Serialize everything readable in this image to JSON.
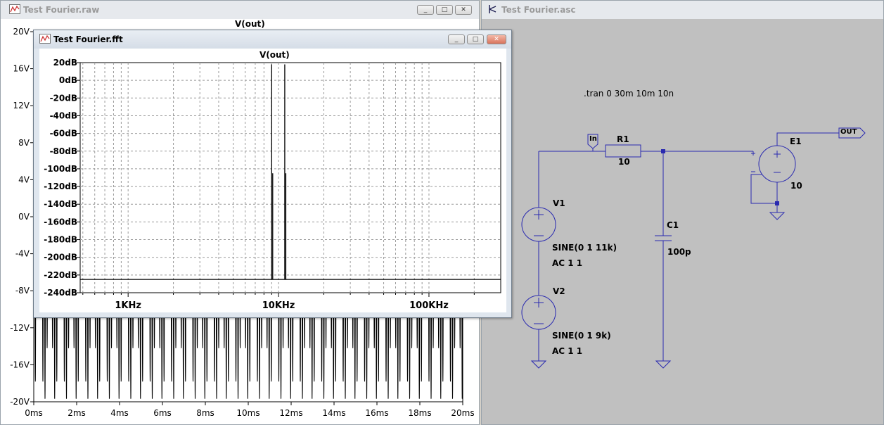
{
  "raw_window": {
    "title": "Test Fourier.raw",
    "trace_name": "V(out)",
    "y_ticks": [
      "20V",
      "16V",
      "12V",
      "8V",
      "4V",
      "0V",
      "-4V",
      "-8V",
      "-12V",
      "-16V",
      "-20V"
    ],
    "x_ticks": [
      "0ms",
      "2ms",
      "4ms",
      "6ms",
      "8ms",
      "10ms",
      "12ms",
      "14ms",
      "16ms",
      "18ms",
      "20ms"
    ],
    "buttons": {
      "minimize": "_",
      "maximize": "□",
      "close": "✕"
    }
  },
  "fft_window": {
    "title": "Test Fourier.fft",
    "trace_name": "V(out)",
    "buttons": {
      "minimize": "_",
      "maximize": "□",
      "close": "✕"
    }
  },
  "asc_window": {
    "title": "Test Fourier.asc",
    "directive": ".tran 0 30m 10m 10n",
    "components": {
      "in_label": "In",
      "r1_name": "R1",
      "r1_value": "10",
      "c1_name": "C1",
      "c1_value": "100p",
      "v1_name": "V1",
      "v1_value": "SINE(0 1 11k)",
      "v1_ac": "AC 1 1",
      "v2_name": "V2",
      "v2_value": "SINE(0 1 9k)",
      "v2_ac": "AC 1 1",
      "e1_name": "E1",
      "e1_value": "10",
      "out_label": "OUT"
    },
    "buttons": {
      "minimize": "_",
      "maximize": "□",
      "close": "✕"
    }
  },
  "chart_data": [
    {
      "type": "line",
      "title": "V(out)",
      "xlabel": "",
      "ylabel": "",
      "x_ticks": [
        "0ms",
        "2ms",
        "4ms",
        "6ms",
        "8ms",
        "10ms",
        "12ms",
        "14ms",
        "16ms",
        "18ms",
        "20ms"
      ],
      "y_ticks": [
        "20V",
        "16V",
        "12V",
        "8V",
        "4V",
        "0V",
        "-4V",
        "-8V",
        "-12V",
        "-16V",
        "-20V"
      ],
      "xlim": [
        0,
        20
      ],
      "ylim": [
        -20,
        20
      ],
      "series": [
        {
          "name": "V(out)",
          "signal": "sum of sines 9 kHz + 11 kHz",
          "amplitude_approx": 20,
          "color": "#000000"
        }
      ]
    },
    {
      "type": "line",
      "title": "V(out)",
      "xlabel": "",
      "ylabel": "",
      "x_scale": "log",
      "x_ticks": [
        "1KHz",
        "10KHz",
        "100KHz"
      ],
      "y_ticks": [
        "20dB",
        "0dB",
        "-20dB",
        "-40dB",
        "-60dB",
        "-80dB",
        "-100dB",
        "-120dB",
        "-140dB",
        "-160dB",
        "-180dB",
        "-200dB",
        "-220dB",
        "-240dB"
      ],
      "ylim": [
        -240,
        20
      ],
      "noise_floor_db": -225,
      "peaks": [
        {
          "freq_hz": 9000,
          "db": 18
        },
        {
          "freq_hz": 11000,
          "db": 18
        }
      ],
      "grid": true,
      "color": "#000000"
    }
  ]
}
